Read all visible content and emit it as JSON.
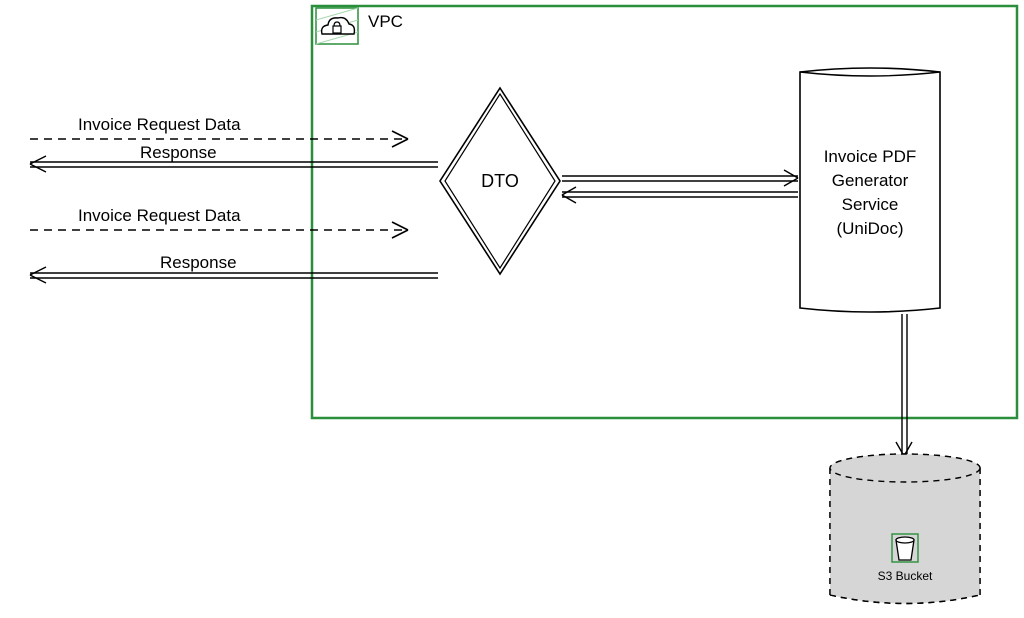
{
  "vpc": {
    "label": "VPC"
  },
  "arrows": {
    "req1": "Invoice Request Data",
    "resp1": "Response",
    "req2": "Invoice Request Data",
    "resp2": "Response"
  },
  "dto": {
    "label": "DTO"
  },
  "service": {
    "line1": "Invoice PDF",
    "line2": "Generator",
    "line3": "Service",
    "line4": "(UniDoc)"
  },
  "storage": {
    "label": "S3 Bucket"
  },
  "colors": {
    "vpc_border": "#2a8f3b",
    "stroke": "#000000",
    "bucket_fill": "#d6d6d6"
  }
}
